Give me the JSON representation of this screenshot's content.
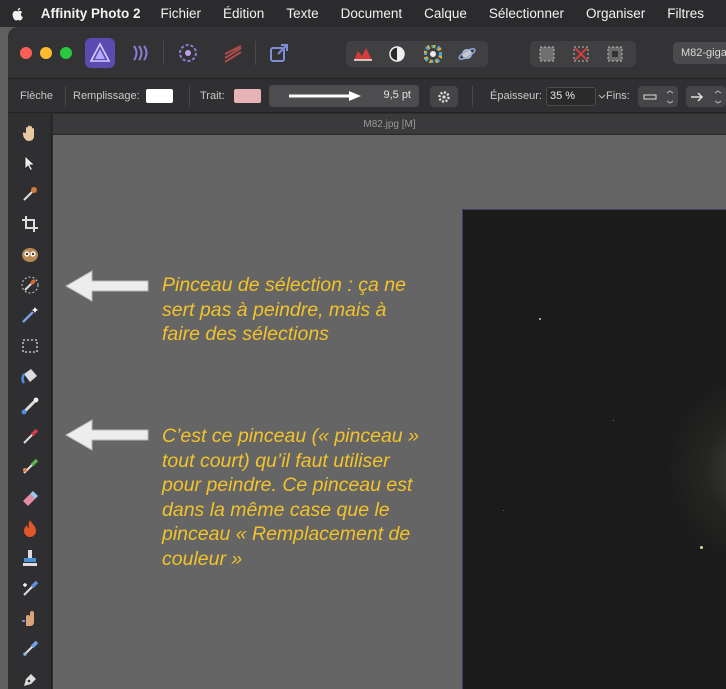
{
  "menubar": {
    "app_name": "Affinity Photo 2",
    "menus": [
      "Fichier",
      "Édition",
      "Texte",
      "Document",
      "Calque",
      "Sélectionner",
      "Organiser",
      "Filtres"
    ]
  },
  "titlebar": {
    "document_chip": "M82-gigapi"
  },
  "context_toolbar": {
    "tool_name": "Flèche",
    "fill_label": "Remplissage:",
    "fill_color": "#ffffff",
    "stroke_label": "Trait:",
    "stroke_color": "#e6b3b6",
    "stroke_width": "9,5 pt",
    "thickness_label": "Épaisseur:",
    "thickness_value": "35 %",
    "ends_label": "Fins:"
  },
  "document": {
    "tab_title": "M82.jpg [M]"
  },
  "tools": [
    "hand-tool-icon",
    "move-tool-icon",
    "color-picker-tool-icon",
    "crop-tool-icon",
    "red-eye-tool-icon",
    "selection-brush-tool-icon",
    "flood-select-tool-icon",
    "marquee-tool-icon",
    "flood-fill-tool-icon",
    "gradient-tool-icon",
    "paint-brush-tool-icon",
    "mixer-brush-tool-icon",
    "erase-brush-tool-icon",
    "burn-tool-icon",
    "clone-tool-icon",
    "healing-brush-tool-icon",
    "smudge-tool-icon",
    "blur-brush-tool-icon",
    "pen-tool-icon"
  ],
  "annotations": {
    "selection_brush_note": "Pinceau de sélection : ça ne\nsert pas à peindre, mais à\nfaire des sélections",
    "paint_brush_note": "C’est ce pinceau (« pinceau »\ntout court) qu’il faut utiliser\npour peindre. Ce pinceau est\ndans la même case que le\npinceau « Remplacement de\ncouleur »",
    "text_color": "#f2c32a",
    "arrow_color": "#ededed"
  }
}
